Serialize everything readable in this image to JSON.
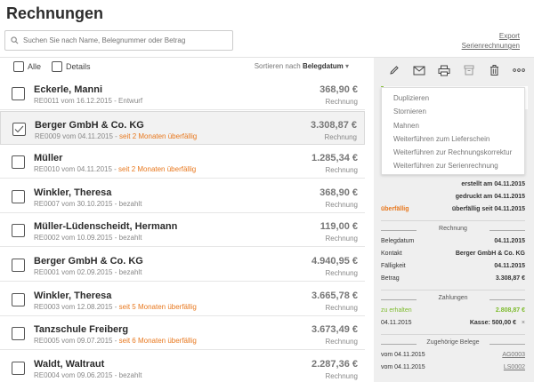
{
  "page": {
    "title": "Rechnungen"
  },
  "search": {
    "placeholder": "Suchen Sie nach Name, Belegnummer oder Betrag"
  },
  "links": {
    "export": "Export",
    "series": "Serienrechnungen"
  },
  "list_header": {
    "all": "Alle",
    "details": "Details",
    "sort_prefix": "Sortieren nach",
    "sort_field": "Belegdatum",
    "sort_arrow": "▾"
  },
  "invoices": [
    {
      "name": "Eckerle, Manni",
      "meta": "RE0011 vom 16.12.2015 - ",
      "status": "Entwurf",
      "overdue": false,
      "amount": "368,90 €",
      "type": "Rechnung",
      "checked": false
    },
    {
      "name": "Berger GmbH & Co. KG",
      "meta": "RE0009 vom 04.11.2015 - ",
      "status": "seit 2 Monaten überfällig",
      "overdue": true,
      "amount": "3.308,87 €",
      "type": "Rechnung",
      "checked": true
    },
    {
      "name": "Müller",
      "meta": "RE0010 vom 04.11.2015 - ",
      "status": "seit 2 Monaten überfällig",
      "overdue": true,
      "amount": "1.285,34 €",
      "type": "Rechnung",
      "checked": false
    },
    {
      "name": "Winkler, Theresa",
      "meta": "RE0007 vom 30.10.2015 - ",
      "status": "bezahlt",
      "overdue": false,
      "amount": "368,90 €",
      "type": "Rechnung",
      "checked": false
    },
    {
      "name": "Müller-Lüdenscheidt, Hermann",
      "meta": "RE0002 vom 10.09.2015 - ",
      "status": "bezahlt",
      "overdue": false,
      "amount": "119,00 €",
      "type": "Rechnung",
      "checked": false
    },
    {
      "name": "Berger GmbH & Co. KG",
      "meta": "RE0001 vom 02.09.2015 - ",
      "status": "bezahlt",
      "overdue": false,
      "amount": "4.940,95 €",
      "type": "Rechnung",
      "checked": false
    },
    {
      "name": "Winkler, Theresa",
      "meta": "RE0003 vom 12.08.2015 - ",
      "status": "seit 5 Monaten überfällig",
      "overdue": true,
      "amount": "3.665,78 €",
      "type": "Rechnung",
      "checked": false
    },
    {
      "name": "Tanzschule Freiberg",
      "meta": "RE0005 vom 09.07.2015 - ",
      "status": "seit 6 Monaten überfällig",
      "overdue": true,
      "amount": "3.673,49 €",
      "type": "Rechnung",
      "checked": false
    },
    {
      "name": "Waldt, Waltraut",
      "meta": "RE0004 vom 09.06.2015 - ",
      "status": "bezahlt",
      "overdue": false,
      "amount": "2.287,36 €",
      "type": "Rechnung",
      "checked": false
    }
  ],
  "toolbar_icons": [
    "pencil-icon",
    "envelope-icon",
    "printer-icon",
    "archive-icon",
    "trash-icon",
    "more-icon"
  ],
  "dropdown": {
    "items": [
      "Duplizieren",
      "Stornieren",
      "Mahnen",
      "Weiterführen zum Lieferschein",
      "Weiterführen zur Rechnungskorrektur",
      "Weiterführen zur Serienrechnung"
    ]
  },
  "details": {
    "created": "erstellt am 04.11.2015",
    "printed": "gedruckt am 04.11.2015",
    "overdue_label": "überfällig",
    "overdue_value": "überfällig seit 04.11.2015",
    "invoice_section": "Rechnung",
    "invoice_rows": [
      {
        "k": "Belegdatum",
        "v": "04.11.2015"
      },
      {
        "k": "Kontakt",
        "v": "Berger GmbH & Co. KG"
      },
      {
        "k": "Fälligkeit",
        "v": "04.11.2015"
      },
      {
        "k": "Betrag",
        "v": "3.308,87 €"
      }
    ],
    "payments_section": "Zahlungen",
    "to_receive_label": "zu erhalten",
    "to_receive_value": "2.808,87 €",
    "payment_date": "04.11.2015",
    "payment_value": "Kasse: 500,00 €",
    "payment_close": "×",
    "docs_section": "Zugehörige Belege",
    "docs": [
      {
        "k": "vom 04.11.2015",
        "v": "AG0003"
      },
      {
        "k": "vom 04.11.2015",
        "v": "LS0002"
      }
    ]
  },
  "colors": {
    "accent_green": "#8dc63f",
    "overdue_orange": "#e8781e"
  }
}
